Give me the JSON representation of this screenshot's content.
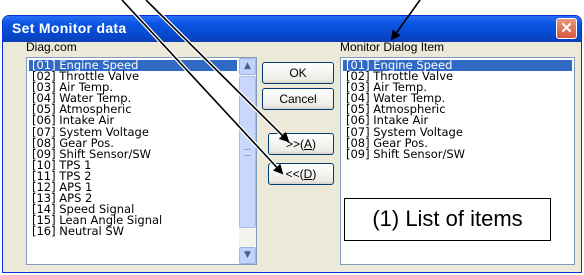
{
  "window": {
    "title": "Set Monitor data",
    "close_glyph": "✕"
  },
  "left_list": {
    "label": "Diag.com",
    "items": [
      "[01] Engine Speed",
      "[02] Throttle Valve",
      "[03] Air Temp.",
      "[04] Water Temp.",
      "[05] Atmospheric",
      "[06] Intake Air",
      "[07] System Voltage",
      "[08] Gear Pos.",
      "[09] Shift Sensor/SW",
      "[10] TPS 1",
      "[11] TPS 2",
      "[12] APS 1",
      "[13] APS 2",
      "[14] Speed Signal",
      "[15] Lean Angle Signal",
      "[16] Neutral SW"
    ],
    "selected_index": 0
  },
  "right_list": {
    "label": "Monitor Dialog Item",
    "items": [
      "[01] Engine Speed",
      "[02] Throttle Valve",
      "[03] Air Temp.",
      "[04] Water Temp.",
      "[05] Atmospheric",
      "[06] Intake Air",
      "[07] System Voltage",
      "[08] Gear Pos.",
      "[09] Shift Sensor/SW"
    ],
    "selected_index": 0
  },
  "buttons": {
    "ok": "OK",
    "cancel": "Cancel",
    "add_prefix": ">>(",
    "add_key": "A",
    "add_suffix": ")",
    "remove_prefix": "<<(",
    "remove_key": "D",
    "remove_suffix": ")"
  },
  "scrollbar": {
    "up_glyph": "▲",
    "down_glyph": "▼"
  },
  "callout": {
    "text": "(1) List of items"
  }
}
